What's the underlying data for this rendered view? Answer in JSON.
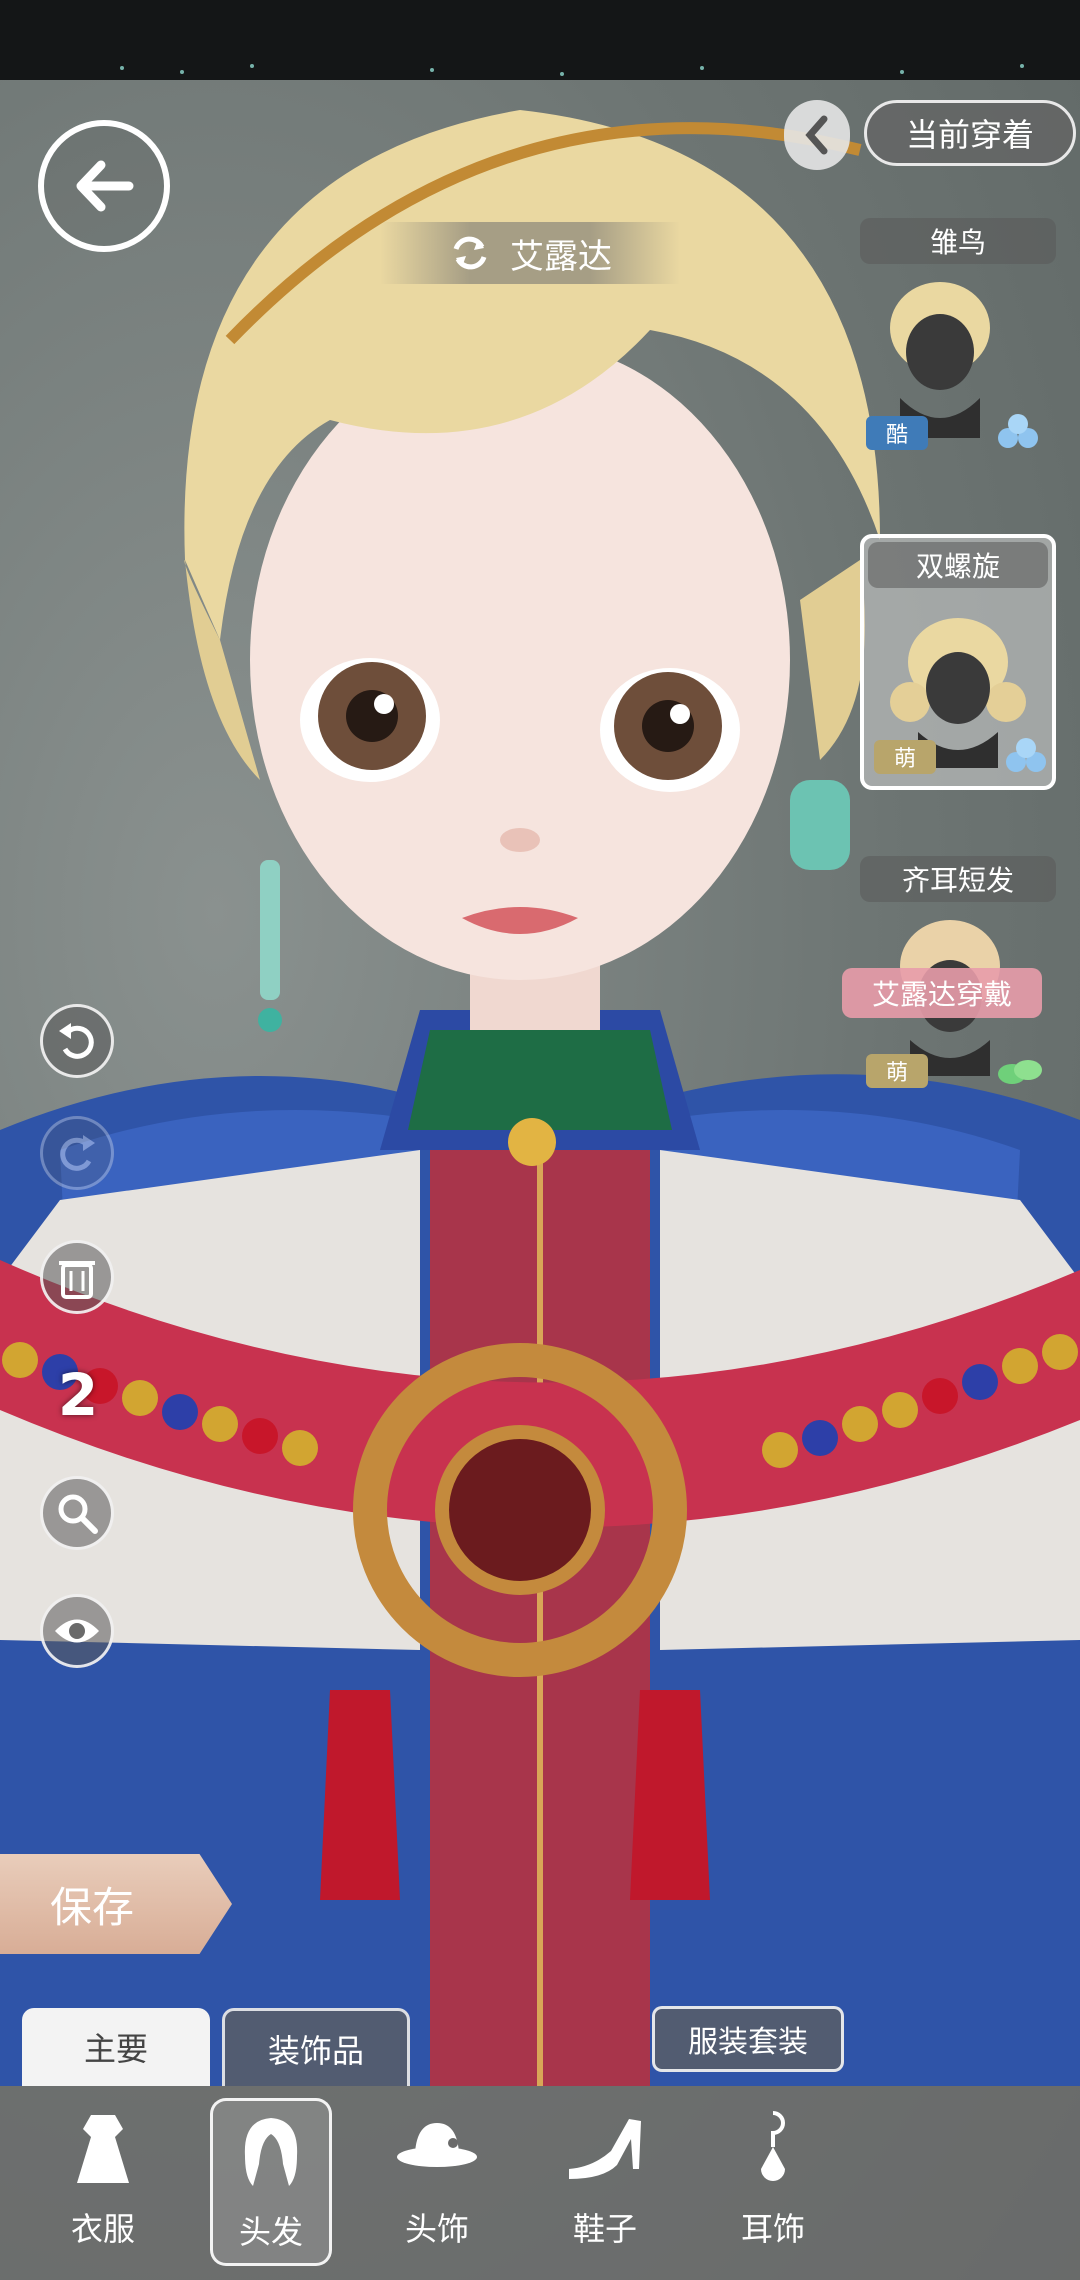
{
  "character": {
    "name": "艾露达"
  },
  "header": {
    "current_outfit_label": "当前穿着"
  },
  "hair_options": [
    {
      "name": "雏鸟",
      "tag": "酷",
      "selected": false,
      "worn": false
    },
    {
      "name": "双螺旋",
      "tag": "萌",
      "selected": true,
      "worn": false
    },
    {
      "name": "齐耳短发",
      "tag": "萌",
      "selected": false,
      "worn": true,
      "worn_label": "艾露达穿戴"
    }
  ],
  "tools": {
    "counter": "2"
  },
  "actions": {
    "save_label": "保存",
    "outfit_set_label": "服装套装"
  },
  "tabs": [
    {
      "label": "主要",
      "active": true
    },
    {
      "label": "装饰品",
      "active": false
    }
  ],
  "categories": [
    {
      "label": "衣服",
      "icon": "dress-icon",
      "active": false
    },
    {
      "label": "头发",
      "icon": "hair-icon",
      "active": true
    },
    {
      "label": "头饰",
      "icon": "hat-icon",
      "active": false
    },
    {
      "label": "鞋子",
      "icon": "heel-shoe-icon",
      "active": false
    },
    {
      "label": "耳饰",
      "icon": "earring-icon",
      "active": false
    }
  ],
  "colors": {
    "tag_cool": "#3f7bb8",
    "tag_cute": "#b8a56b",
    "worn_badge": "#e89caa",
    "save": "#dcb39d"
  }
}
